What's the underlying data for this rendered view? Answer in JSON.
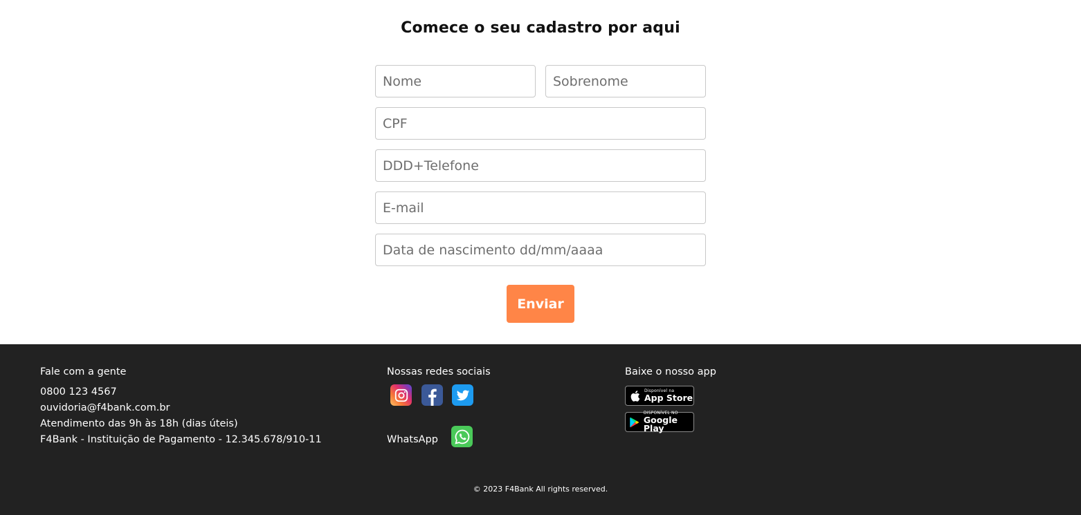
{
  "form": {
    "title": "Comece o seu cadastro por aqui",
    "fields": {
      "first_name_placeholder": "Nome",
      "last_name_placeholder": "Sobrenome",
      "cpf_placeholder": "CPF",
      "phone_placeholder": "DDD+Telefone",
      "email_placeholder": "E-mail",
      "birthdate_placeholder": "Data de nascimento dd/mm/aaaa"
    },
    "submit_label": "Enviar",
    "accent_color": "#ff8547"
  },
  "footer": {
    "background_color": "#222222",
    "contact": {
      "heading": "Fale com a gente",
      "phone": "0800 123 4567",
      "email": "ouvidoria@f4bank.com.br",
      "hours": "Atendimento das 9h às 18h (dias úteis)",
      "company": "F4Bank - Instituição de Pagamento - 12.345.678/910-11"
    },
    "social": {
      "heading": "Nossas redes sociais",
      "icons": [
        "instagram-icon",
        "facebook-icon",
        "twitter-icon"
      ],
      "whatsapp_label": "WhatsApp",
      "whatsapp_icon": "whatsapp-icon"
    },
    "app": {
      "heading": "Baixe o nosso app",
      "app_store_small": "Disponível na",
      "app_store_big": "App Store",
      "google_play_small": "DISPONÍVEL NO",
      "google_play_big": "Google Play"
    },
    "copyright": "© 2023 F4Bank All rights reserved."
  }
}
